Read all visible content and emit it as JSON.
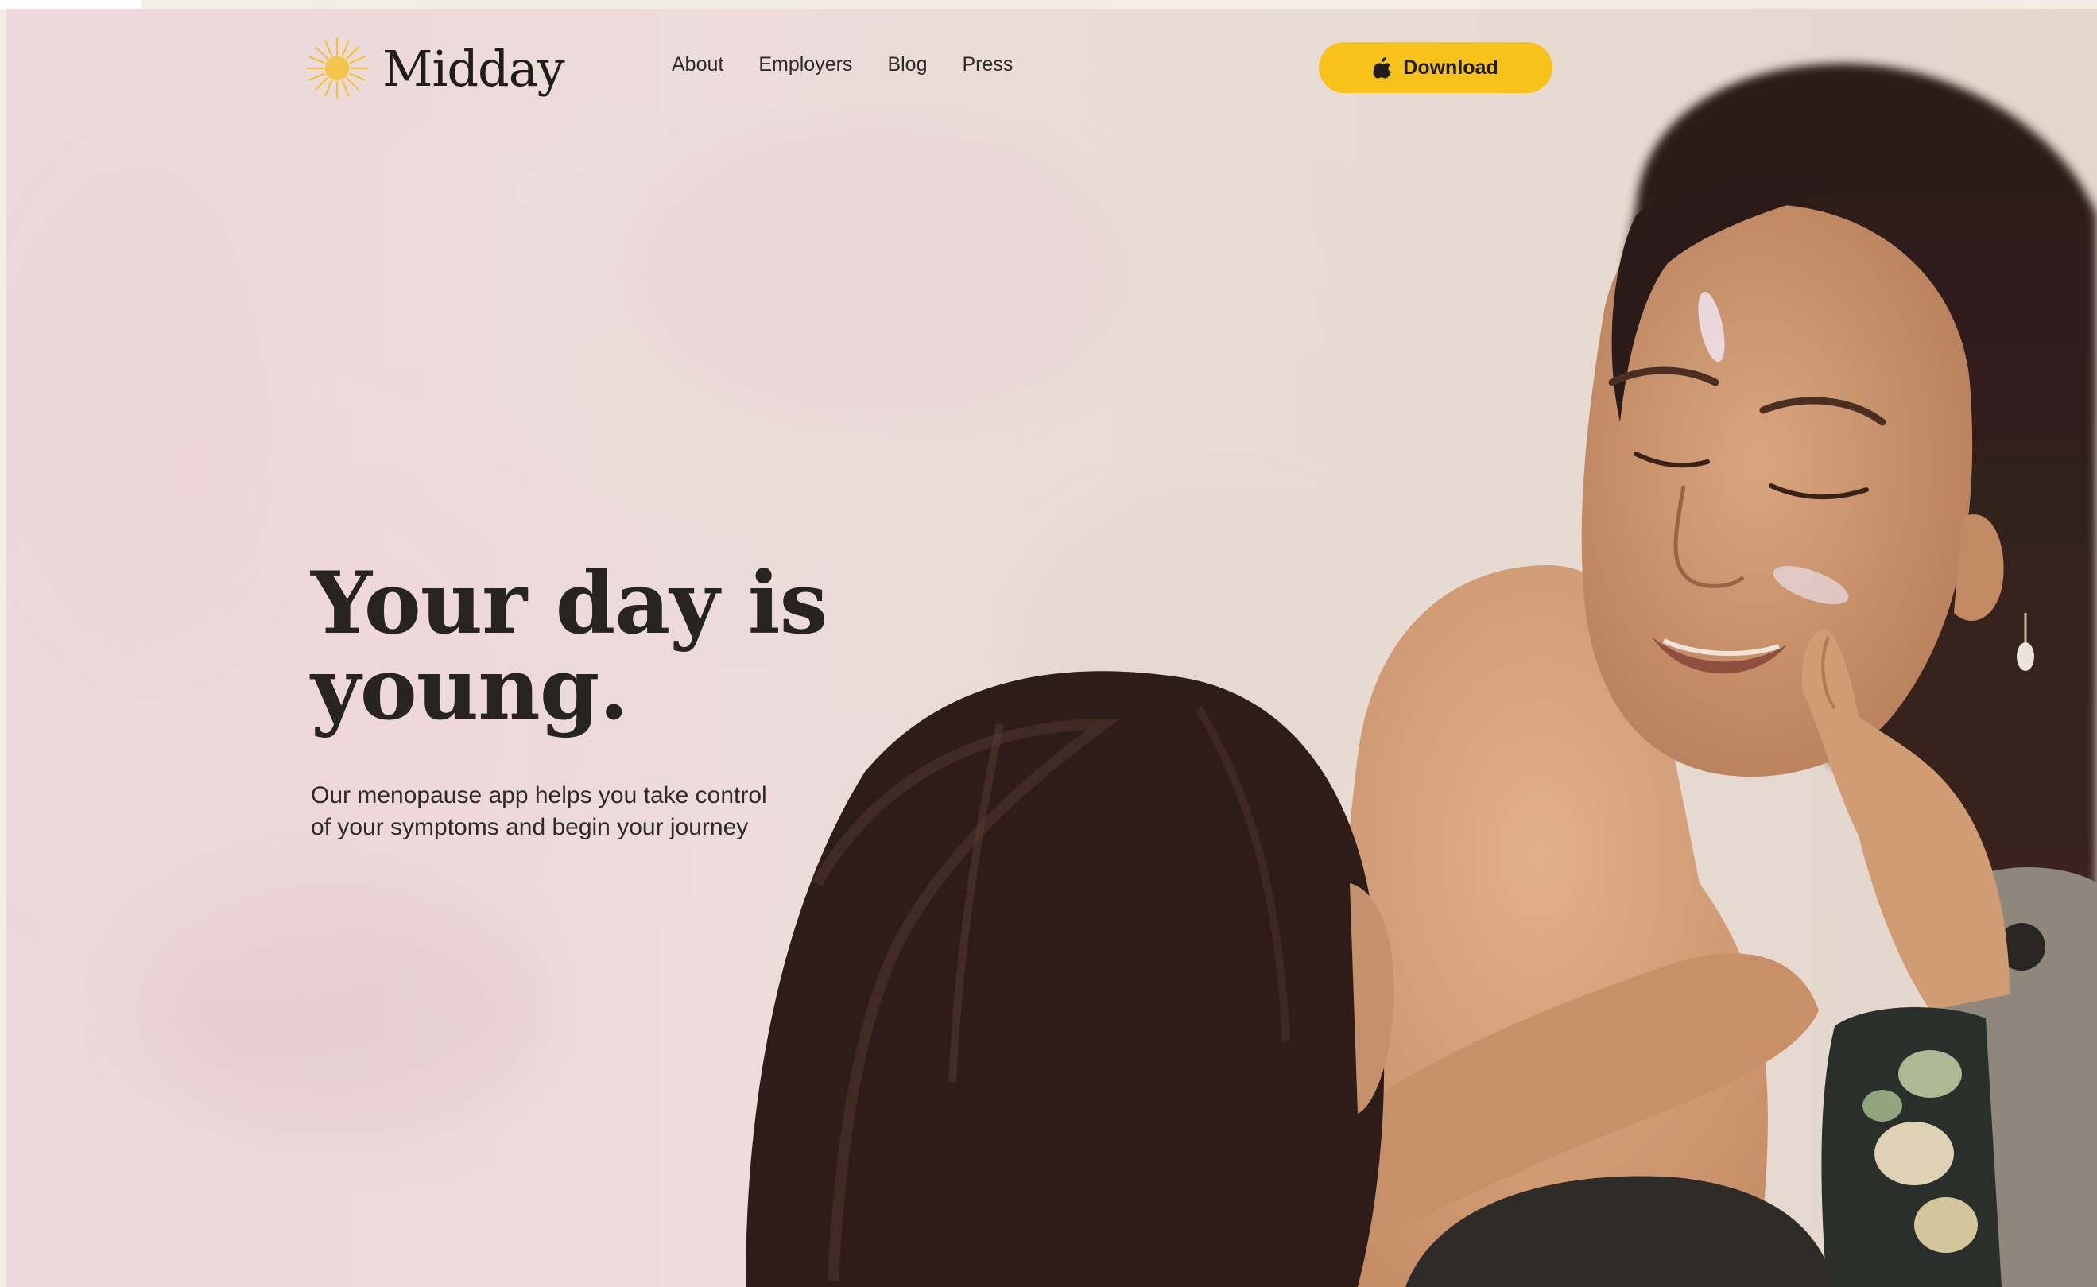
{
  "brand": {
    "name": "Midday",
    "logo_icon": "sun-icon",
    "logo_color": "#f2c233"
  },
  "nav": {
    "links": [
      "About",
      "Employers",
      "Blog",
      "Press"
    ]
  },
  "cta": {
    "label": "Download",
    "icon": "apple-icon",
    "color": "#f7c21b"
  },
  "hero": {
    "headline_line1": "Your day is",
    "headline_line2": "young.",
    "subtext_line1": "Our menopause app helps you take control",
    "subtext_line2": "of your symptoms and begin your journey"
  }
}
